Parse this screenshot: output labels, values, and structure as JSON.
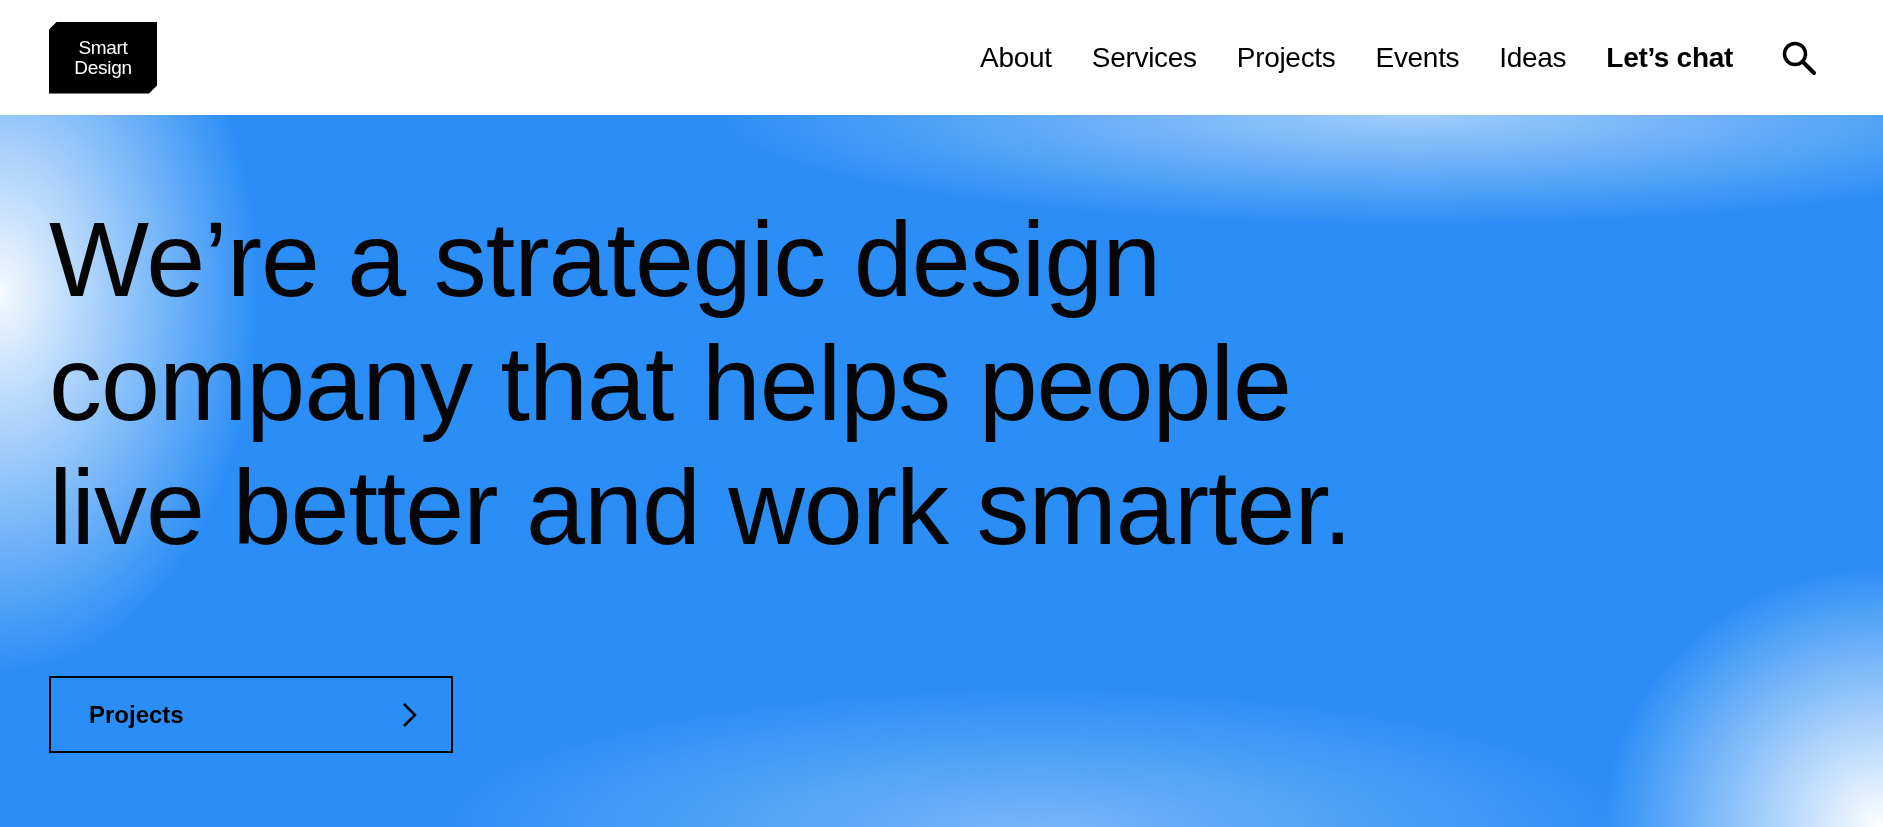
{
  "logo": {
    "lines": [
      "Smart",
      "Design"
    ]
  },
  "nav": {
    "items": [
      {
        "label": "About",
        "kind": "link"
      },
      {
        "label": "Services",
        "kind": "link"
      },
      {
        "label": "Projects",
        "kind": "link"
      },
      {
        "label": "Events",
        "kind": "link"
      },
      {
        "label": "Ideas",
        "kind": "link"
      },
      {
        "label": "Let’s chat",
        "kind": "cta"
      }
    ]
  },
  "hero": {
    "headline": [
      "We’re a strategic design",
      "company that helps people",
      "live better and work smarter."
    ],
    "button": {
      "label": "Projects"
    }
  }
}
